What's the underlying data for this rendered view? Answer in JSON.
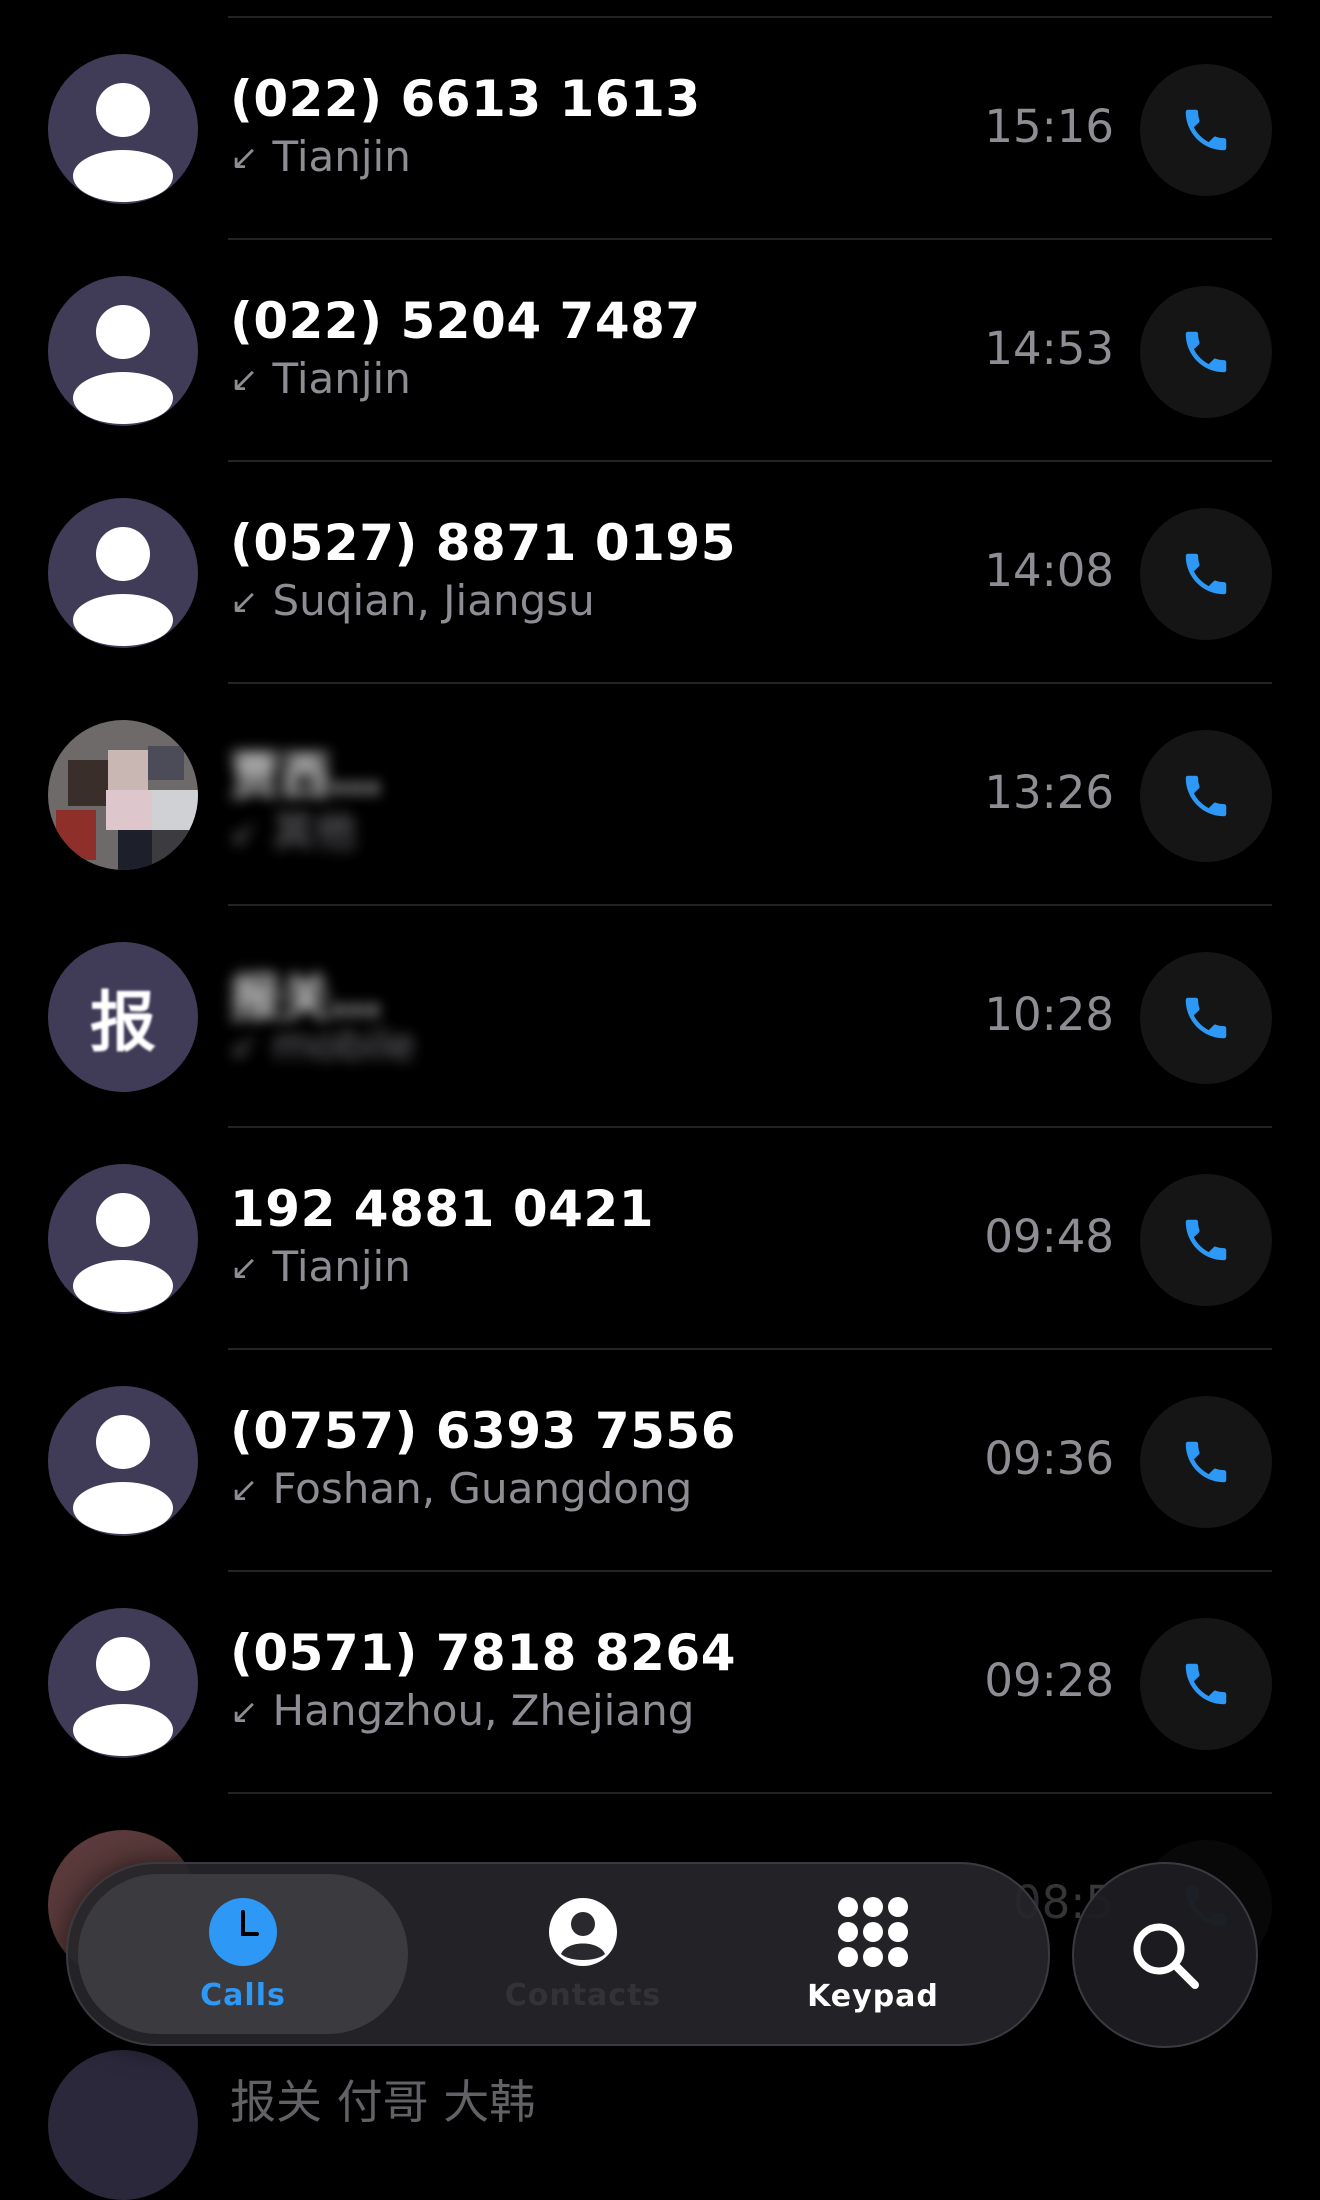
{
  "calls": [
    {
      "name": "(022) 6613 1613",
      "direction_icon": "incoming-arrow-icon",
      "location": "Tianjin",
      "time": "15:16",
      "avatar": "generic-person-icon"
    },
    {
      "name": "(022) 5204 7487",
      "direction_icon": "incoming-arrow-icon",
      "location": "Tianjin",
      "time": "14:53",
      "avatar": "generic-person-icon"
    },
    {
      "name": "(0527) 8871 0195",
      "direction_icon": "incoming-arrow-icon",
      "location": "Suqian, Jiangsu",
      "time": "14:08",
      "avatar": "generic-person-icon"
    },
    {
      "name": "贾西…",
      "direction_icon": "incoming-arrow-icon",
      "location": "其他",
      "time": "13:26",
      "avatar": "photo"
    },
    {
      "name": "报关…",
      "direction_icon": "incoming-arrow-icon",
      "location": "mobile",
      "time": "10:28",
      "avatar": "letter",
      "avatar_letter": "报"
    },
    {
      "name": "192 4881 0421",
      "direction_icon": "incoming-arrow-icon",
      "location": "Tianjin",
      "time": "09:48",
      "avatar": "generic-person-icon"
    },
    {
      "name": "(0757) 6393 7556",
      "direction_icon": "incoming-arrow-icon",
      "location": "Foshan, Guangdong",
      "time": "09:36",
      "avatar": "generic-person-icon"
    },
    {
      "name": "(0571) 7818 8264",
      "direction_icon": "incoming-arrow-icon",
      "location": "Hangzhou, Zhejiang",
      "time": "09:28",
      "avatar": "generic-person-icon"
    }
  ],
  "partial_row": {
    "time": "08:5"
  },
  "bottom_peek_text": "报关   付哥   大韩",
  "tab_bar": {
    "calls_label": "Calls",
    "contacts_label": "Contacts",
    "keypad_label": "Keypad"
  },
  "colors": {
    "accent": "#2d98f5",
    "avatar_bg": "#403c58",
    "secondary_text": "#8d8d93",
    "divider": "#242428"
  },
  "icons": {
    "call_button": "phone-icon",
    "calls_tab": "clock-icon",
    "contacts_tab": "person-circle-icon",
    "keypad_tab": "keypad-grid-icon",
    "search": "search-icon"
  }
}
